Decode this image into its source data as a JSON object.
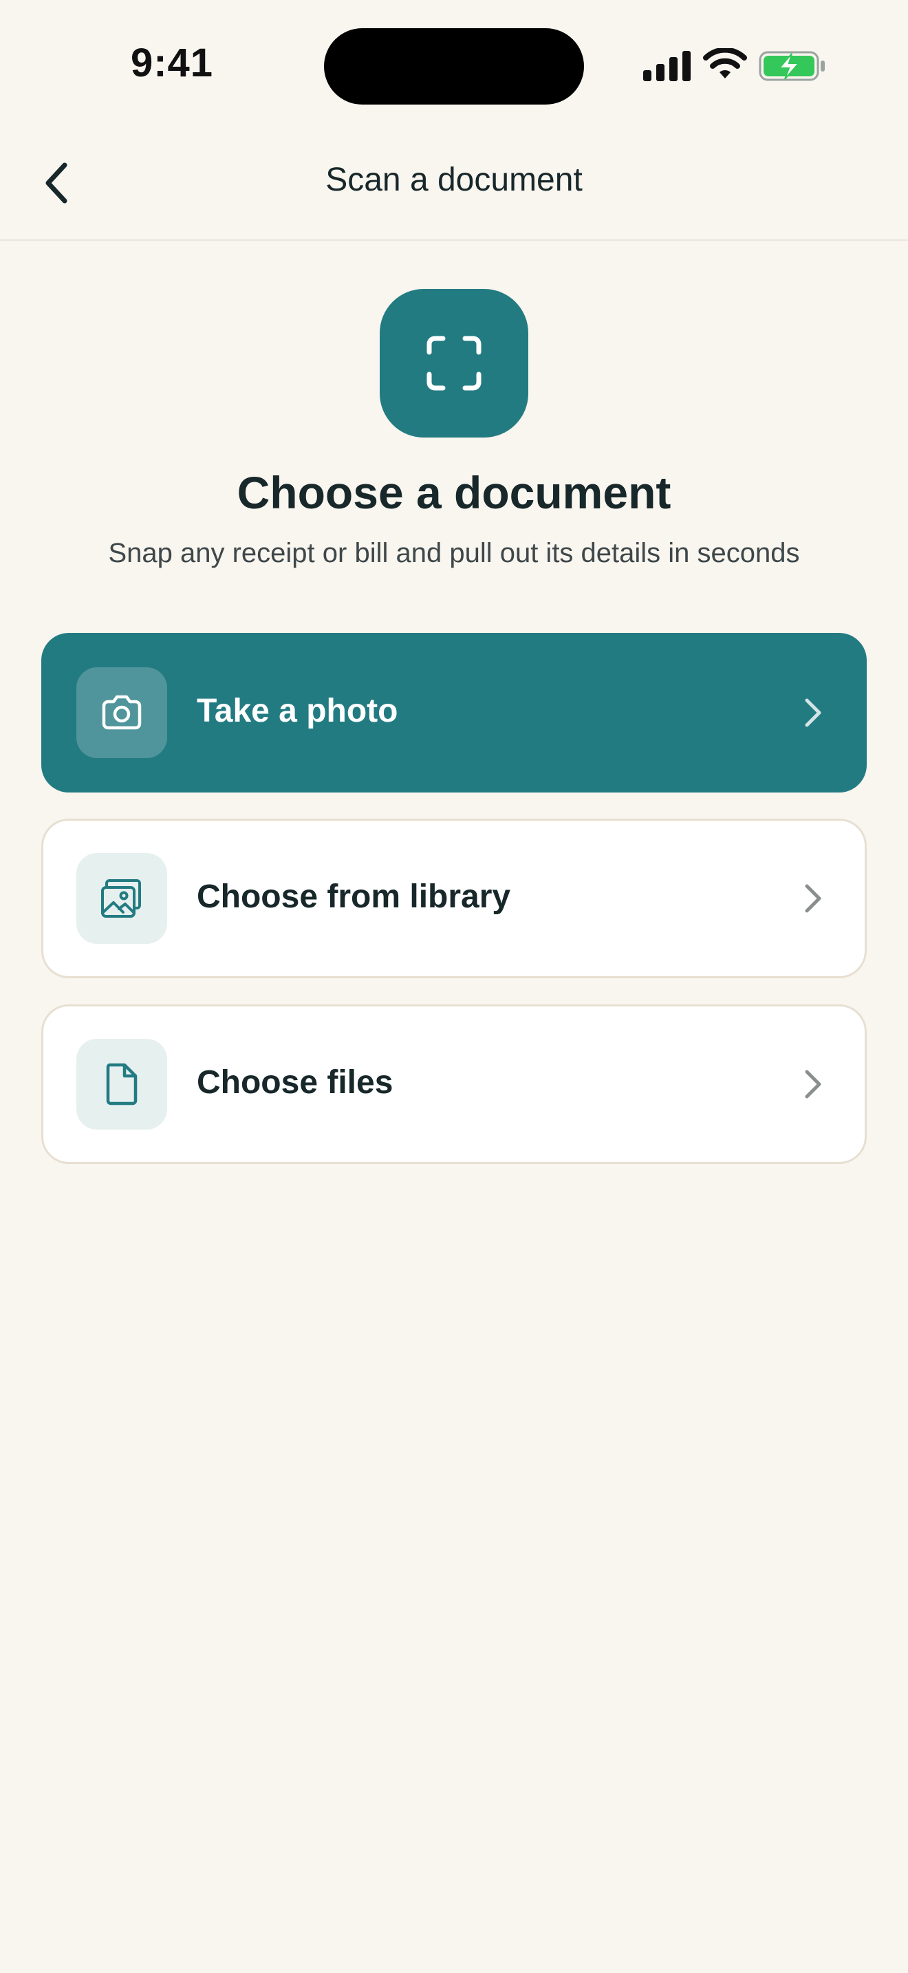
{
  "status_bar": {
    "time": "9:41"
  },
  "nav": {
    "title": "Scan a document"
  },
  "hero": {
    "title": "Choose a document",
    "subtitle": "Snap any receipt or bill and pull out its details in seconds"
  },
  "options": [
    {
      "label": "Take a photo",
      "icon": "camera-icon"
    },
    {
      "label": "Choose from library",
      "icon": "image-gallery-icon"
    },
    {
      "label": "Choose files",
      "icon": "file-icon"
    }
  ],
  "colors": {
    "background": "#f9f5ef",
    "accent": "#237b82",
    "text": "#17272a",
    "battery": "#34c759"
  }
}
